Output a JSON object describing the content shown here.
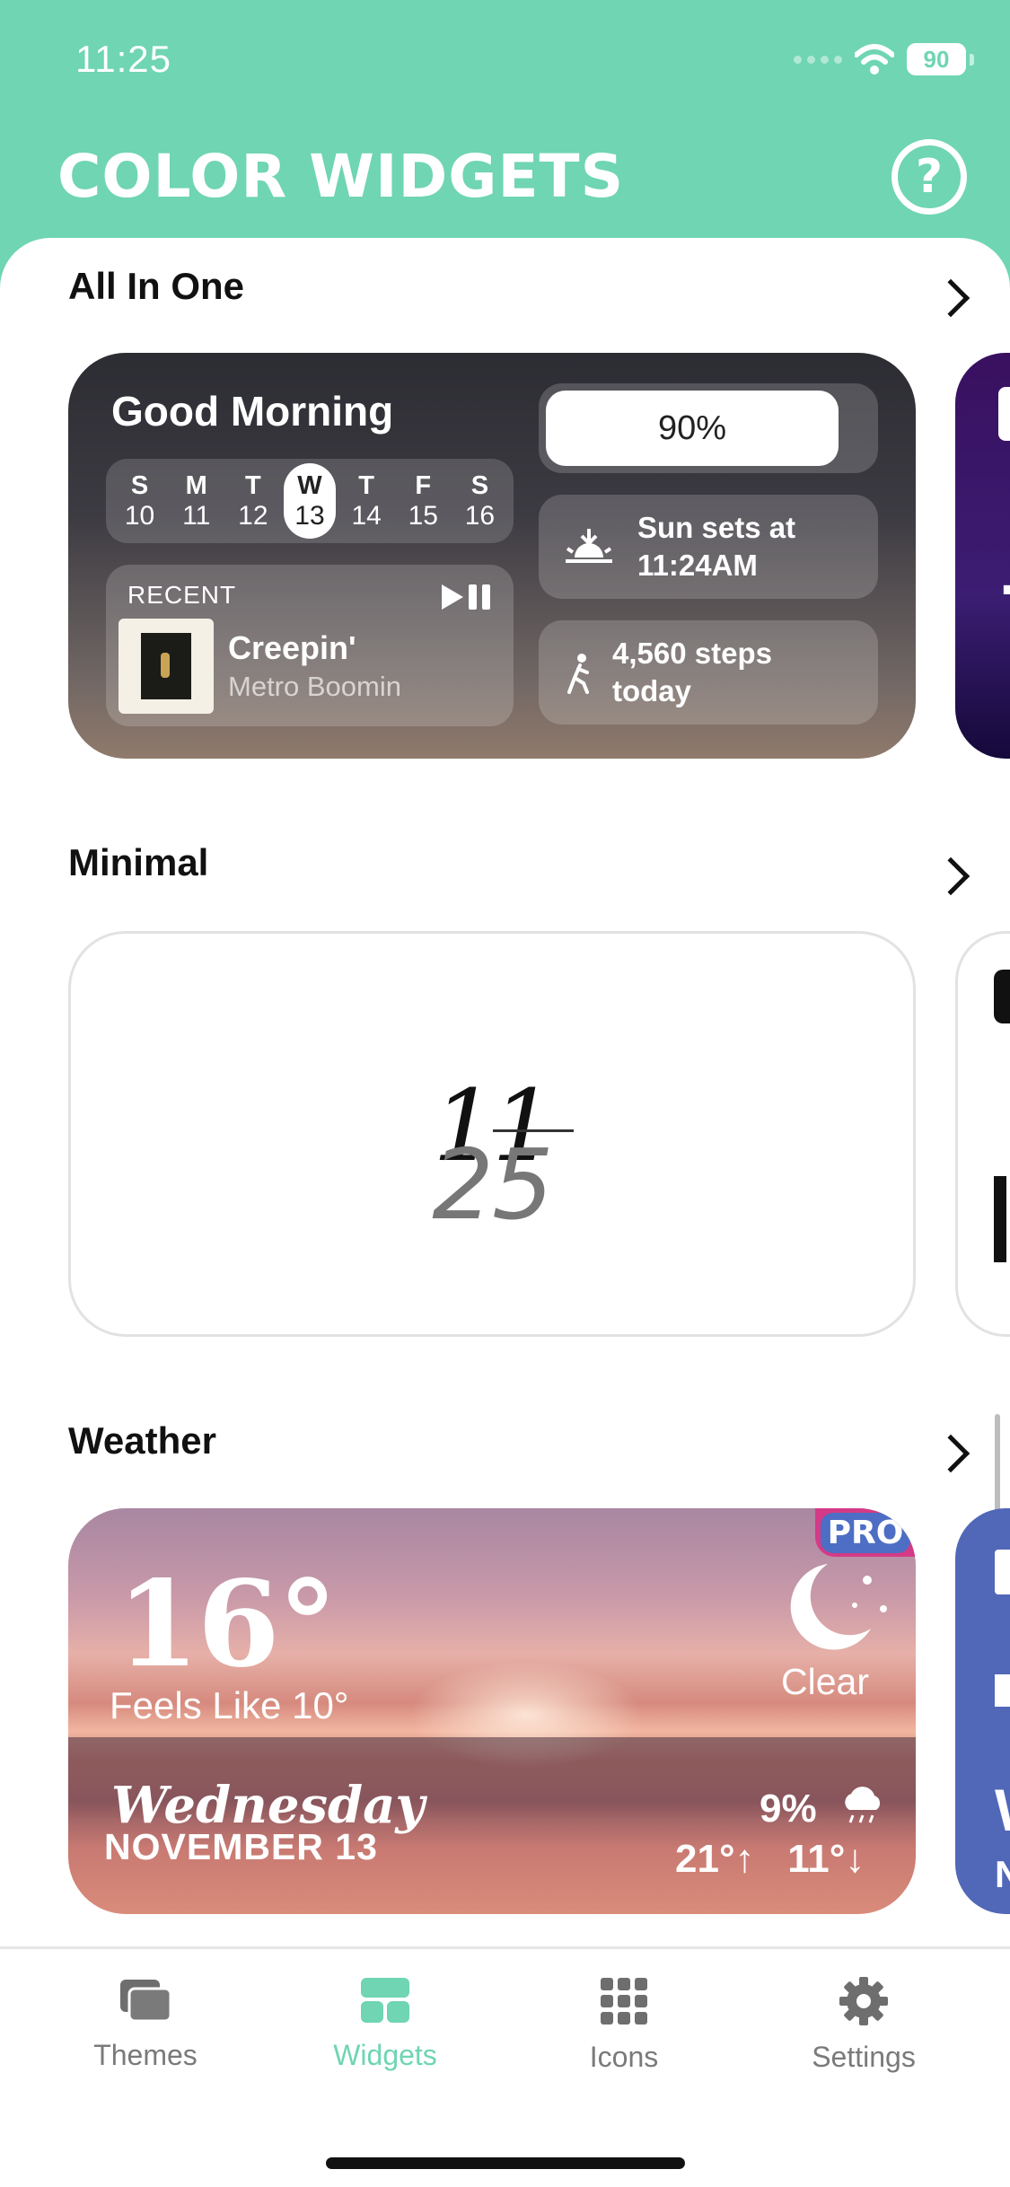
{
  "status": {
    "time": "11:25",
    "battery": "90"
  },
  "app": {
    "title": "COLOR WIDGETS",
    "help_label": "?"
  },
  "sections": {
    "all_in_one": {
      "title": "All In One",
      "greeting": "Good Morning",
      "calendar": [
        {
          "letter": "S",
          "num": "10"
        },
        {
          "letter": "M",
          "num": "11"
        },
        {
          "letter": "T",
          "num": "12"
        },
        {
          "letter": "W",
          "num": "13"
        },
        {
          "letter": "T",
          "num": "14"
        },
        {
          "letter": "F",
          "num": "15"
        },
        {
          "letter": "S",
          "num": "16"
        }
      ],
      "recent_label": "RECENT",
      "song": "Creepin'",
      "artist": "Metro Boomin",
      "battery_pct": "90%",
      "battery_level": 0.9,
      "sunset_line1": "Sun sets at",
      "sunset_line2": "11:24AM",
      "steps_line1": "4,560 steps",
      "steps_line2": "today"
    },
    "minimal": {
      "title": "Minimal",
      "hour": "11",
      "minute": "25"
    },
    "weather": {
      "title": "Weather",
      "pro_badge": "PRO",
      "temp": "16°",
      "feels_like": "Feels Like 10°",
      "condition": "Clear",
      "day": "Wednesday",
      "date": "NOVEMBER 13",
      "precip": "9%",
      "high": "21°↑",
      "low": "11°↓"
    }
  },
  "tabs": [
    {
      "label": "Themes",
      "icon": "themes-icon"
    },
    {
      "label": "Widgets",
      "icon": "widgets-icon"
    },
    {
      "label": "Icons",
      "icon": "icons-grid-icon"
    },
    {
      "label": "Settings",
      "icon": "gear-icon"
    }
  ],
  "colors": {
    "accent": "#6fd5b2",
    "tab_inactive": "#7a7a7a"
  }
}
